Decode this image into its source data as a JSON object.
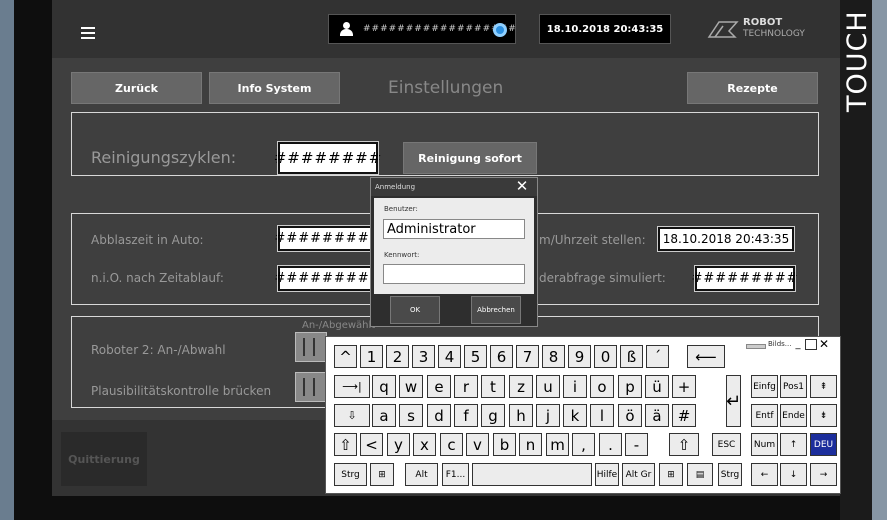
{
  "header": {
    "menu_icon": "hamburger-icon",
    "user_field": "##################",
    "datetime": "18.10.2018 20:43:35",
    "logo_line1": "ROBOT",
    "logo_line2": "TECHNOLOGY"
  },
  "nav": {
    "back": "Zurück",
    "info": "Info System",
    "title": "Einstellungen",
    "recipes": "Rezepte"
  },
  "cleaning": {
    "label": "Reinigungszyklen:",
    "value": "########",
    "button": "Reinigung sofort"
  },
  "settings": {
    "blowoff_label": "Abblaszeit in Auto:",
    "blowoff_value": "#########",
    "nio_label": "n.i.O. nach Zeitablauf:",
    "nio_value": "#########",
    "time_label": "m/Uhrzeit stellen:",
    "time_value": "18.10.2018 20:43:35",
    "sim_label": "derabfrage simuliert:",
    "sim_value": "#########"
  },
  "robot": {
    "group_label": "An-/Abgewählt",
    "robot2_label": "Roboter 2: An-/Abwahl",
    "plausibility_label": "Plausibilitätskontrolle brücken"
  },
  "footer": {
    "acknowledge": "Quittierung"
  },
  "side_label": "TOUCH",
  "dialog": {
    "title": "Anmeldung",
    "user_label": "Benutzer:",
    "user_value": "Administrator",
    "password_label": "Kennwort:",
    "password_value": "",
    "ok": "OK",
    "cancel": "Abbrechen"
  },
  "keyboard": {
    "title": "Bilds...",
    "row1": [
      "^",
      "1",
      "2",
      "3",
      "4",
      "5",
      "6",
      "7",
      "8",
      "9",
      "0",
      "ß",
      "´",
      "⟵"
    ],
    "row2": [
      "⟶|",
      "q",
      "w",
      "e",
      "r",
      "t",
      "z",
      "u",
      "i",
      "o",
      "p",
      "ü",
      "+"
    ],
    "row3": [
      "⇩",
      "a",
      "s",
      "d",
      "f",
      "g",
      "h",
      "j",
      "k",
      "l",
      "ö",
      "ä",
      "#"
    ],
    "row4": [
      "⇧",
      "<",
      "y",
      "x",
      "c",
      "v",
      "b",
      "n",
      "m",
      ",",
      ".",
      "-",
      "⇧",
      "ESC"
    ],
    "row5": [
      "Strg",
      "⊞",
      "Alt",
      "F1...",
      "",
      "Hilfe",
      "Alt Gr",
      "⊞",
      "▤",
      "Strg"
    ],
    "enter": "↵",
    "nav": [
      "Einfg",
      "Pos1",
      "⇞",
      "Entf",
      "Ende",
      "⇟",
      "Num",
      "↑",
      "DEU",
      "←",
      "↓",
      "→"
    ]
  }
}
